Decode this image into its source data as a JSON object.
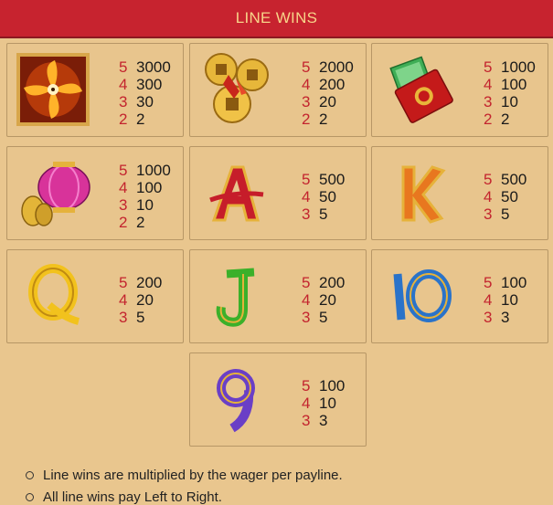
{
  "header": {
    "title": "LINE WINS"
  },
  "symbols": [
    {
      "name": "pinwheel",
      "pays": [
        [
          "5",
          "3000"
        ],
        [
          "4",
          "300"
        ],
        [
          "3",
          "30"
        ],
        [
          "2",
          "2"
        ]
      ]
    },
    {
      "name": "coins",
      "pays": [
        [
          "5",
          "2000"
        ],
        [
          "4",
          "200"
        ],
        [
          "3",
          "20"
        ],
        [
          "2",
          "2"
        ]
      ]
    },
    {
      "name": "red-envelope",
      "pays": [
        [
          "5",
          "1000"
        ],
        [
          "4",
          "100"
        ],
        [
          "3",
          "10"
        ],
        [
          "2",
          "2"
        ]
      ]
    },
    {
      "name": "lantern",
      "pays": [
        [
          "5",
          "1000"
        ],
        [
          "4",
          "100"
        ],
        [
          "3",
          "10"
        ],
        [
          "2",
          "2"
        ]
      ]
    },
    {
      "name": "A",
      "pays": [
        [
          "5",
          "500"
        ],
        [
          "4",
          "50"
        ],
        [
          "3",
          "5"
        ]
      ]
    },
    {
      "name": "K",
      "pays": [
        [
          "5",
          "500"
        ],
        [
          "4",
          "50"
        ],
        [
          "3",
          "5"
        ]
      ]
    },
    {
      "name": "Q",
      "pays": [
        [
          "5",
          "200"
        ],
        [
          "4",
          "20"
        ],
        [
          "3",
          "5"
        ]
      ]
    },
    {
      "name": "J",
      "pays": [
        [
          "5",
          "200"
        ],
        [
          "4",
          "20"
        ],
        [
          "3",
          "5"
        ]
      ]
    },
    {
      "name": "10",
      "pays": [
        [
          "5",
          "100"
        ],
        [
          "4",
          "10"
        ],
        [
          "3",
          "3"
        ]
      ]
    },
    {
      "name": "9",
      "pays": [
        [
          "5",
          "100"
        ],
        [
          "4",
          "10"
        ],
        [
          "3",
          "3"
        ]
      ]
    }
  ],
  "notes": [
    "Line wins are multiplied by the wager per payline.",
    "All line wins pay Left to Right."
  ],
  "colors": {
    "header_bg": "#c7232f",
    "header_text": "#f7d489",
    "background": "#e9c68e",
    "count": "#c3242e"
  }
}
